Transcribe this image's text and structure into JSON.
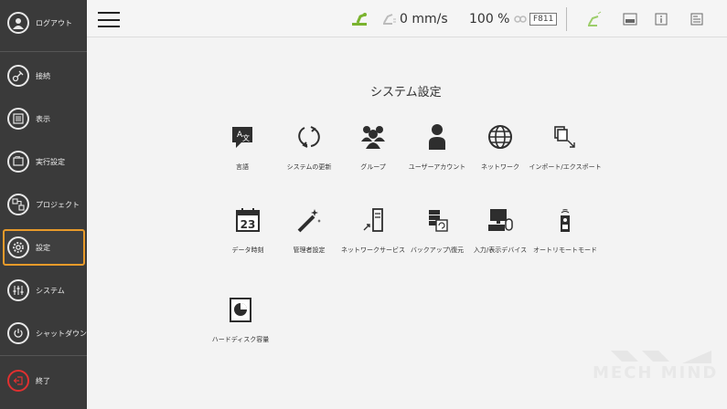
{
  "sidebar": {
    "items": [
      {
        "label": "ログアウト",
        "icon": "user-icon"
      },
      {
        "label": "接続",
        "icon": "connect-icon"
      },
      {
        "label": "表示",
        "icon": "list-icon"
      },
      {
        "label": "実行設定",
        "icon": "folder-icon"
      },
      {
        "label": "プロジェクト",
        "icon": "project-icon"
      },
      {
        "label": "設定",
        "icon": "gear-icon"
      },
      {
        "label": "システム",
        "icon": "sliders-icon"
      },
      {
        "label": "シャットダウン",
        "icon": "power-icon"
      },
      {
        "label": "終了",
        "icon": "exit-icon"
      }
    ],
    "active": "設定"
  },
  "topbar": {
    "speed": "0 mm/s",
    "percent": "100 %",
    "code": "F811"
  },
  "main": {
    "title": "システム設定",
    "tiles": [
      {
        "label": "言語",
        "icon": "language-icon"
      },
      {
        "label": "システムの更新",
        "icon": "update-icon"
      },
      {
        "label": "グループ",
        "icon": "group-icon"
      },
      {
        "label": "ユーザーアカウント",
        "icon": "user-account-icon"
      },
      {
        "label": "ネットワーク",
        "icon": "globe-icon"
      },
      {
        "label": "インポート/エクスポート",
        "icon": "import-export-icon"
      },
      {
        "label": "データ時刻",
        "icon": "calendar-icon"
      },
      {
        "label": "管理者設定",
        "icon": "admin-wand-icon"
      },
      {
        "label": "ネットワークサービス",
        "icon": "network-service-icon"
      },
      {
        "label": "バックアップ\\復元",
        "icon": "backup-icon"
      },
      {
        "label": "入力/表示デバイス",
        "icon": "io-device-icon"
      },
      {
        "label": "オートリモートモード",
        "icon": "remote-icon"
      },
      {
        "label": "ハードディスク容量",
        "icon": "disk-icon"
      }
    ],
    "calendar_day": "23"
  },
  "watermark": "MECH MIND",
  "colors": {
    "sidebar_bg": "#3a3a3a",
    "active_border": "#e89a2a",
    "exit": "#e03030",
    "robot_green": "#7ab32e"
  }
}
